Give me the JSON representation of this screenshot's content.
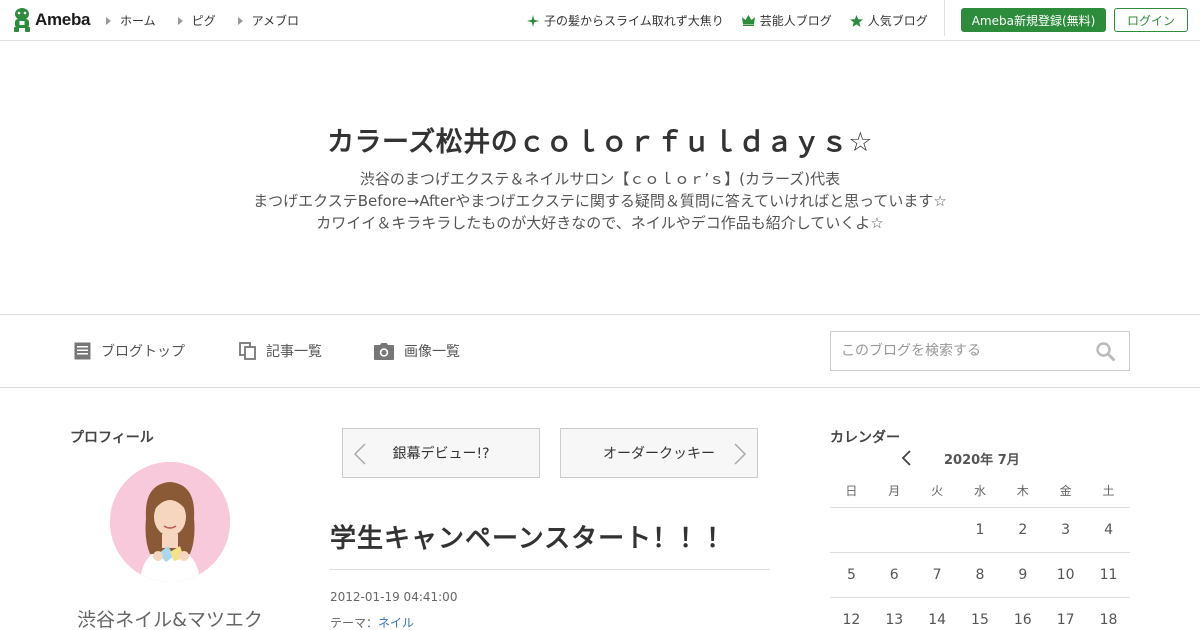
{
  "topbar": {
    "logo_text": "Ameba",
    "nav": [
      {
        "label": "ホーム"
      },
      {
        "label": "ピグ"
      },
      {
        "label": "アメブロ"
      }
    ],
    "links": [
      {
        "label": "子の髪からスライム取れず大焦り",
        "icon": "sparkle-icon"
      },
      {
        "label": "芸能人ブログ",
        "icon": "crown-icon"
      },
      {
        "label": "人気ブログ",
        "icon": "star-icon"
      }
    ],
    "register_label": "Ameba新規登録(無料)",
    "login_label": "ログイン",
    "accent_color": "#2d8c3c"
  },
  "header": {
    "title": "カラーズ松井のｃｏｌｏｒｆｕｌｄａｙｓ☆",
    "description": [
      "渋谷のまつげエクステ＆ネイルサロン【ｃｏｌｏｒ’ｓ】(カラーズ)代表",
      "まつげエクステBefore→Afterやまつげエクステに関する疑問＆質問に答えていければと思っています☆",
      "カワイイ＆キラキラしたものが大好きなので、ネイルやデコ作品も紹介していくよ☆"
    ]
  },
  "blognav": {
    "items": [
      {
        "label": "ブログトップ",
        "icon": "document-icon"
      },
      {
        "label": "記事一覧",
        "icon": "copy-icon"
      },
      {
        "label": "画像一覧",
        "icon": "camera-icon"
      }
    ],
    "search_placeholder": "このブログを検索する"
  },
  "sidebar_left": {
    "profile_heading": "プロフィール",
    "profile_name": "渋谷ネイル&マツエク"
  },
  "main": {
    "prev_label": "銀幕デビュー!?",
    "next_label": "オーダークッキー",
    "entry_title": "学生キャンペーンスタート！！！",
    "entry_date": "2012-01-19 04:41:00",
    "theme_prefix": "テーマ：",
    "theme_label": "ネイル"
  },
  "calendar": {
    "heading": "カレンダー",
    "month_label": "2020年 7月",
    "weekdays": [
      "日",
      "月",
      "火",
      "水",
      "木",
      "金",
      "土"
    ],
    "weeks": [
      [
        "",
        "",
        "",
        "1",
        "2",
        "3",
        "4"
      ],
      [
        "5",
        "6",
        "7",
        "8",
        "9",
        "10",
        "11"
      ],
      [
        "12",
        "13",
        "14",
        "15",
        "16",
        "17",
        "18"
      ]
    ]
  }
}
